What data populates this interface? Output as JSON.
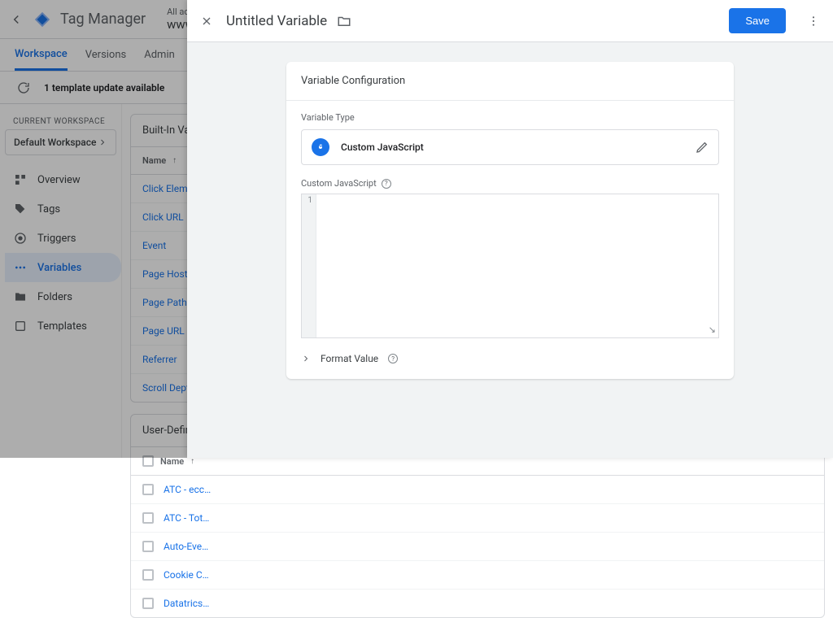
{
  "header": {
    "product": "Tag Manager",
    "breadcrumb": "All accounts > Twi…",
    "account": "www.twist…"
  },
  "tabs": {
    "workspace": "Workspace",
    "versions": "Versions",
    "admin": "Admin"
  },
  "template_banner": "1 template update available",
  "workspace": {
    "label": "CURRENT WORKSPACE",
    "current": "Default Workspace"
  },
  "sidebar": {
    "items": [
      {
        "label": "Overview"
      },
      {
        "label": "Tags"
      },
      {
        "label": "Triggers"
      },
      {
        "label": "Variables"
      },
      {
        "label": "Folders"
      },
      {
        "label": "Templates"
      }
    ]
  },
  "builtins": {
    "title": "Built-In Varia…",
    "name_col": "Name",
    "rows": [
      "Click Element",
      "Click URL",
      "Event",
      "Page Hostnam…",
      "Page Path",
      "Page URL",
      "Referrer",
      "Scroll Depth T…"
    ]
  },
  "userdef": {
    "title": "User-Defined…",
    "name_col": "Name",
    "rows": [
      "ATC - ecc…",
      "ATC - Tot…",
      "Auto-Eve…",
      "Cookie C…",
      "Datatrics…"
    ]
  },
  "panel": {
    "title": "Untitled Variable",
    "save": "Save",
    "config_title": "Variable Configuration",
    "variable_type_label": "Variable Type",
    "variable_type_name": "Custom JavaScript",
    "cjs_label": "Custom JavaScript",
    "line_number": "1",
    "format_value": "Format Value"
  }
}
